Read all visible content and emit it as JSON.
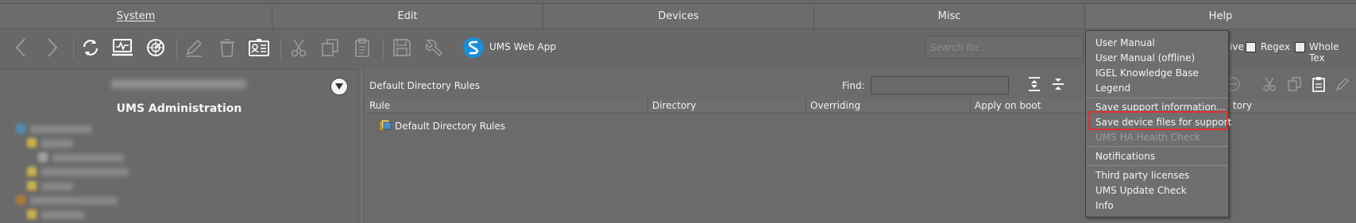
{
  "menu": {
    "items": [
      {
        "label": "System"
      },
      {
        "label": "Edit"
      },
      {
        "label": "Devices"
      },
      {
        "label": "Misc"
      },
      {
        "label": "Help"
      }
    ]
  },
  "toolbar": {
    "webapp_label": "UMS Web App",
    "search_placeholder": "Search for...",
    "checkbox_partial_label": "ive",
    "regex_label": "Regex",
    "whole_text_label": "Whole Tex"
  },
  "left_panel": {
    "title": "UMS Administration"
  },
  "right_panel": {
    "title": "Default Directory Rules",
    "find_label": "Find:",
    "find_value": "",
    "columns": [
      "Rule",
      "Directory",
      "Overriding",
      "Apply on boot"
    ],
    "partial_column": "tory",
    "rows": [
      {
        "label": "Default Directory Rules"
      }
    ]
  },
  "help_menu": {
    "items": [
      {
        "label": "User Manual",
        "enabled": true
      },
      {
        "label": "User Manual (offline)",
        "enabled": true
      },
      {
        "label": "IGEL Knowledge Base",
        "enabled": true
      },
      {
        "label": "Legend",
        "enabled": true
      },
      {
        "label": "Save support information...",
        "enabled": true
      },
      {
        "label": "Save device files for support",
        "enabled": true,
        "highlighted": true
      },
      {
        "label": "UMS HA Health Check",
        "enabled": false
      },
      {
        "label": "Notifications",
        "enabled": true
      },
      {
        "label": "Third party licenses",
        "enabled": true
      },
      {
        "label": "UMS Update Check",
        "enabled": true
      },
      {
        "label": "Info",
        "enabled": true
      }
    ]
  },
  "colors": {
    "background": "#686868",
    "highlight": "#e03030",
    "webapp_accent": "#1a8fd8"
  },
  "icons": [
    "back-arrow-icon",
    "forward-arrow-icon",
    "refresh-icon",
    "monitor-icon",
    "radar-icon",
    "edit-pencil-icon",
    "trash-icon",
    "id-card-icon",
    "cut-scissors-icon",
    "copy-icon",
    "paste-clipboard-icon",
    "save-disk-icon",
    "wrench-icon",
    "ums-webapp-icon",
    "collapse-arrow-icon",
    "expand-all-icon",
    "collapse-all-icon",
    "folder-rule-icon"
  ]
}
